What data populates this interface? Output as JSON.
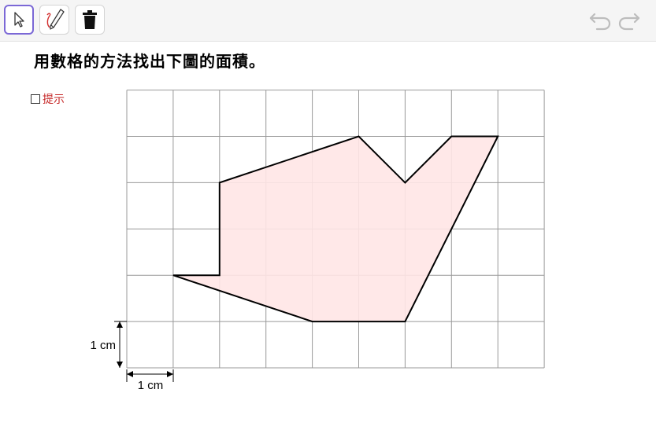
{
  "toolbar": {
    "tools": [
      {
        "name": "move-tool",
        "icon": "arrow-cursor-icon",
        "selected": true
      },
      {
        "name": "pen-tool",
        "icon": "pen-icon",
        "selected": false
      },
      {
        "name": "delete-tool",
        "icon": "trash-icon",
        "selected": false
      }
    ],
    "undo_icon": "undo-icon",
    "redo_icon": "redo-icon"
  },
  "question": {
    "title": "用數格的方法找出下圖的面積。"
  },
  "hint": {
    "label": "提示",
    "checked": false
  },
  "figure": {
    "grid": {
      "columns": 9,
      "rows": 6
    },
    "shape_fill": "#ffe6e6",
    "shape_stroke": "#000000",
    "polygon_vertices_grid_units": [
      [
        1,
        2
      ],
      [
        2,
        2
      ],
      [
        2,
        4
      ],
      [
        5,
        5
      ],
      [
        6,
        4
      ],
      [
        7,
        5
      ],
      [
        8,
        5
      ],
      [
        6,
        1
      ],
      [
        4,
        1
      ]
    ],
    "vertical_dimension_label": "1 cm",
    "horizontal_dimension_label": "1 cm"
  },
  "colors": {
    "accent": "#7b68d6",
    "hint_text": "#c62828",
    "grid_line": "#999999"
  }
}
